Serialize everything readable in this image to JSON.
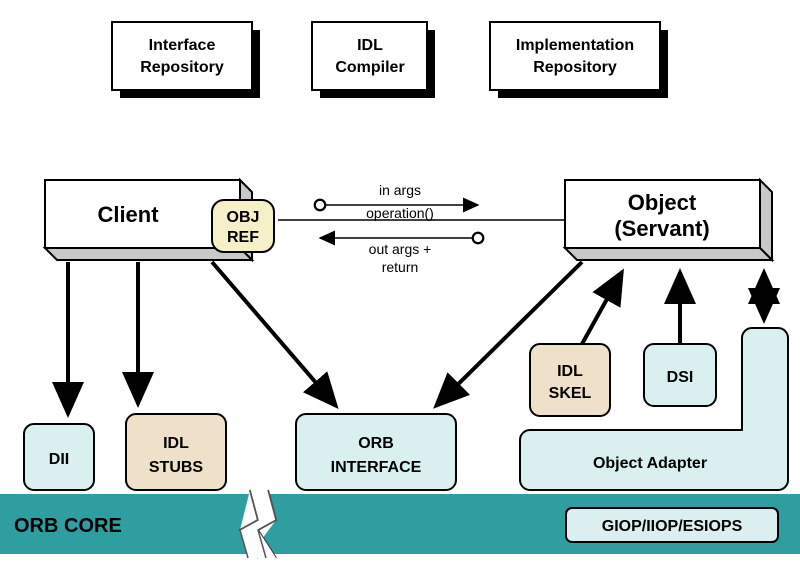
{
  "top_boxes": {
    "interface_repo": [
      "Interface",
      "Repository"
    ],
    "idl_compiler": [
      "IDL",
      "Compiler"
    ],
    "impl_repo": [
      "Implementation",
      "Repository"
    ]
  },
  "client": "Client",
  "object_servant": [
    "Object",
    "(Servant)"
  ],
  "obj_ref": [
    "OBJ",
    "REF"
  ],
  "callout": {
    "in_args": "in args",
    "operation": "operation()",
    "out_args": "out args +",
    "return": "return"
  },
  "components": {
    "dii": "DII",
    "idl_stubs": [
      "IDL",
      "STUBS"
    ],
    "orb_interface": [
      "ORB",
      "INTERFACE"
    ],
    "idl_skel": [
      "IDL",
      "SKEL"
    ],
    "dsi": "DSI",
    "object_adapter": "Object Adapter"
  },
  "orb_core": "ORB CORE",
  "giop": "GIOP/IIOP/ESIOPS"
}
